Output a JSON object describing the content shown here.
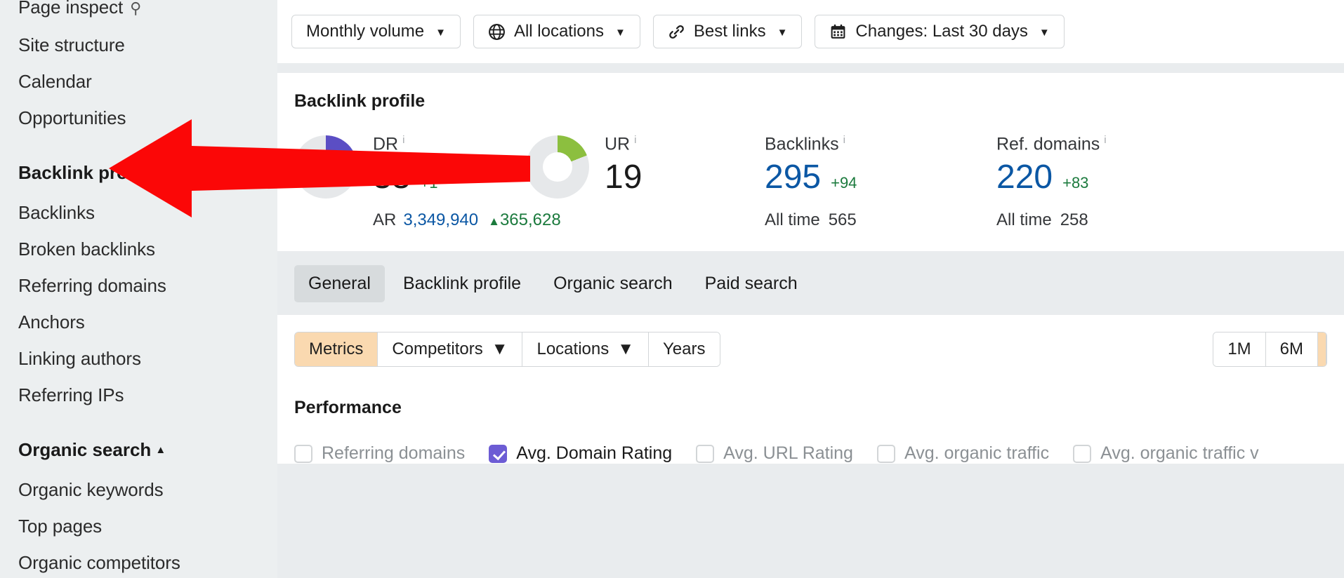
{
  "sidebar": {
    "items": [
      {
        "label": "Page inspect",
        "type": "link",
        "icon": "search-icon",
        "partial": true
      },
      {
        "label": "Site structure",
        "type": "link"
      },
      {
        "label": "Calendar",
        "type": "link"
      },
      {
        "label": "Opportunities",
        "type": "link"
      },
      {
        "label": "Backlink profile",
        "type": "group",
        "caret": "▲"
      },
      {
        "label": "Backlinks",
        "type": "link"
      },
      {
        "label": "Broken backlinks",
        "type": "link"
      },
      {
        "label": "Referring domains",
        "type": "link"
      },
      {
        "label": "Anchors",
        "type": "link"
      },
      {
        "label": "Linking authors",
        "type": "link"
      },
      {
        "label": "Referring IPs",
        "type": "link"
      },
      {
        "label": "Organic search",
        "type": "group",
        "caret": "▲"
      },
      {
        "label": "Organic keywords",
        "type": "link"
      },
      {
        "label": "Top pages",
        "type": "link"
      },
      {
        "label": "Organic competitors",
        "type": "link"
      }
    ]
  },
  "toolbar": {
    "filters": [
      {
        "label": "Monthly volume",
        "icon": "none",
        "caret": "▼"
      },
      {
        "label": "All locations",
        "icon": "globe-icon",
        "caret": "▼"
      },
      {
        "label": "Best links",
        "icon": "link-icon",
        "caret": "▼"
      },
      {
        "label": "Changes: Last 30 days",
        "icon": "calendar-icon",
        "caret": "▼"
      }
    ]
  },
  "backlink_card": {
    "title": "Backlink profile",
    "metrics": [
      {
        "name": "DR",
        "value": "33",
        "delta": "+1",
        "donut_color": "#5b4ec4",
        "donut_pct": 33,
        "sub_label": "AR",
        "sub_value": "3,349,940",
        "sub_delta": "365,628",
        "sub_delta_arrow": "▲"
      },
      {
        "name": "UR",
        "value": "19",
        "delta": "",
        "donut_color": "#8cbf3f",
        "donut_pct": 19,
        "sub_label": "",
        "sub_value": "",
        "sub_delta": ""
      },
      {
        "name": "Backlinks",
        "value": "295",
        "delta": "+94",
        "sub_label": "All time",
        "sub_value": "565"
      },
      {
        "name": "Ref. domains",
        "value": "220",
        "delta": "+83",
        "sub_label": "All time",
        "sub_value": "258"
      }
    ]
  },
  "tabs": [
    {
      "label": "General",
      "active": true
    },
    {
      "label": "Backlink profile",
      "active": false
    },
    {
      "label": "Organic search",
      "active": false
    },
    {
      "label": "Paid search",
      "active": false
    }
  ],
  "segment_control": {
    "left": [
      {
        "label": "Metrics",
        "selected": true,
        "caret": ""
      },
      {
        "label": "Competitors",
        "selected": false,
        "caret": "▼"
      },
      {
        "label": "Locations",
        "selected": false,
        "caret": "▼"
      },
      {
        "label": "Years",
        "selected": false,
        "caret": ""
      }
    ],
    "right": [
      {
        "label": "1M",
        "selected": false
      },
      {
        "label": "6M",
        "selected": false
      }
    ]
  },
  "performance": {
    "title": "Performance",
    "checkboxes": [
      {
        "label": "Referring domains",
        "checked": false
      },
      {
        "label": "Avg. Domain Rating",
        "checked": true
      },
      {
        "label": "Avg. URL Rating",
        "checked": false
      },
      {
        "label": "Avg. organic traffic",
        "checked": false
      },
      {
        "label": "Avg. organic traffic v",
        "checked": false
      }
    ]
  },
  "annotation": {
    "arrow_color": "#fb0707",
    "arrow_direction": "left"
  },
  "colors": {
    "accent_purple": "#6c5cd4",
    "accent_green": "#8cbf3f",
    "link_blue": "#0b57a4",
    "positive_green": "#1b7a3d",
    "selected_orange": "#fad9b0"
  }
}
